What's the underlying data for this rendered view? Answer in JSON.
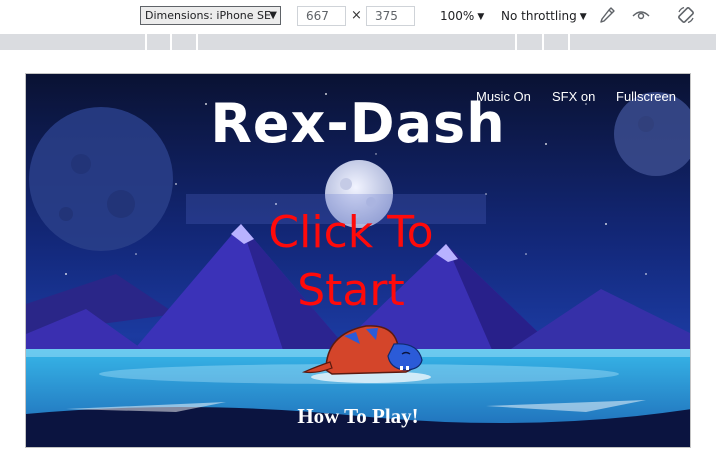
{
  "devtools": {
    "dimensions_label": "Dimensions: iPhone SE",
    "width_value": "667",
    "times_symbol": "×",
    "height_value": "375",
    "zoom_label": "100%",
    "throttling_label": "No throttling",
    "caret": "▼",
    "icons": [
      "eyedropper-icon",
      "eye-icon",
      "rotate-icon"
    ]
  },
  "game": {
    "menu": {
      "music": "Music On",
      "sfx": "SFX on",
      "fullscreen": "Fullscreen"
    },
    "title": "Rex-Dash",
    "start_line1": "Click To",
    "start_line2": "Start",
    "how_to_play": "How To Play!",
    "colors": {
      "sky": "#0b1d55",
      "mountains": "#3a2fb0",
      "ice": "#2a9fd6",
      "start_text": "#ff0a0a",
      "dino": "#d4452a"
    }
  }
}
